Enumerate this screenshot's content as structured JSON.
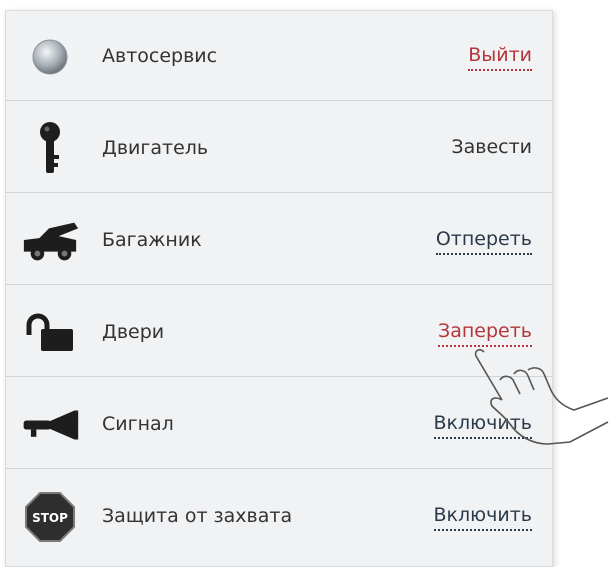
{
  "rows": [
    {
      "label": "Автосервис",
      "action": "Выйти",
      "icon": "service-light-icon"
    },
    {
      "label": "Двигатель",
      "action": "Завести",
      "icon": "key-icon"
    },
    {
      "label": "Багажник",
      "action": "Отпереть",
      "icon": "trunk-icon"
    },
    {
      "label": "Двери",
      "action": "Запереть",
      "icon": "padlock-open-icon"
    },
    {
      "label": "Сигнал",
      "action": "Включить",
      "icon": "horn-icon"
    },
    {
      "label": "Защита от захвата",
      "action": "Включить",
      "icon": "stop-sign-icon"
    }
  ],
  "stop_icon_text": "STOP",
  "colors": {
    "panel_bg": "#f0f2f4",
    "action_red": "#b3363a",
    "action_dark": "#2b3a4a",
    "divider": "#cfd3d7"
  }
}
